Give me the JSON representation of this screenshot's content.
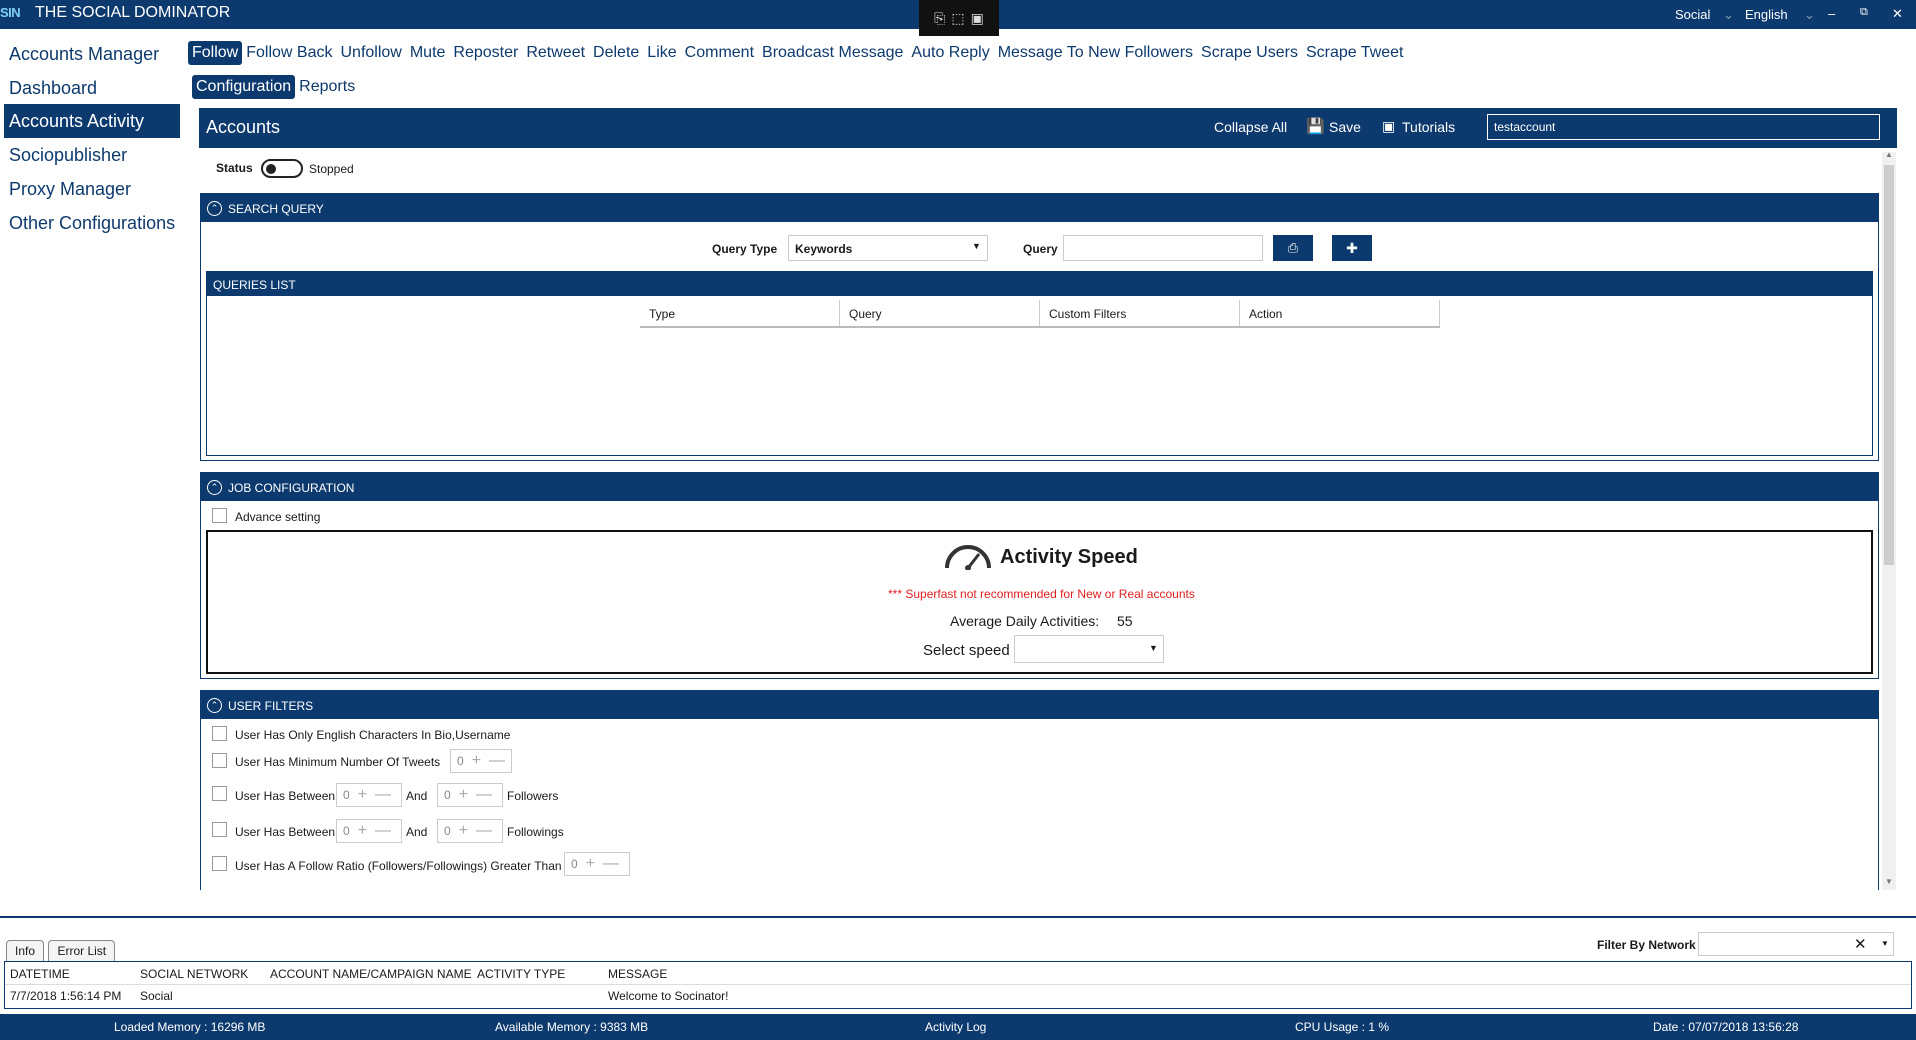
{
  "titlebar": {
    "logo": "SIN",
    "title": "THE SOCIAL DOMINATOR",
    "network": "Social",
    "language": "English",
    "minimize": "–",
    "restore": "⧉",
    "close": "✕"
  },
  "nav": {
    "items": [
      "Accounts Manager",
      "Dashboard",
      "Accounts Activity",
      "Sociopublisher",
      "Proxy Manager",
      "Other Configurations"
    ],
    "active_index": 2
  },
  "tabs": {
    "primary": [
      "Follow",
      "Follow Back",
      "Unfollow",
      "Mute",
      "Reposter",
      "Retweet",
      "Delete",
      "Like",
      "Comment",
      "Broadcast Message",
      "Auto Reply",
      "Message To New Followers",
      "Scrape Users",
      "Scrape Tweet"
    ],
    "secondary": [
      "Configuration",
      "Reports"
    ]
  },
  "accounts_bar": {
    "label": "Accounts",
    "collapse_all": "Collapse All",
    "save": "Save",
    "tutorials": "Tutorials",
    "account_value": "testaccount"
  },
  "status": {
    "label": "Status",
    "value": "Stopped"
  },
  "search_query": {
    "title": "SEARCH QUERY",
    "query_type_label": "Query Type",
    "query_type_value": "Keywords",
    "query_label": "Query",
    "query_value": "",
    "queries_list_title": "QUERIES LIST",
    "columns": [
      "Type",
      "Query",
      "Custom Filters",
      "Action"
    ]
  },
  "job_config": {
    "title": "JOB CONFIGURATION",
    "advance_setting": "Advance setting",
    "activity_speed_title": "Activity Speed",
    "warning": "*** Superfast not recommended for New or Real accounts",
    "avg_label": "Average Daily Activities:",
    "avg_value": "55",
    "select_speed_label": "Select speed",
    "select_speed_value": ""
  },
  "user_filters": {
    "title": "USER FILTERS",
    "f1": "User Has Only English Characters In Bio,Username",
    "f2": "User Has Minimum Number Of Tweets",
    "f3": "User Has Between",
    "and": "And",
    "followers": "Followers",
    "followings": "Followings",
    "f5": "User Has A Follow Ratio (Followers/Followings) Greater Than",
    "zero": "0"
  },
  "log": {
    "tab_info": "Info",
    "tab_errors": "Error List",
    "filter_label": "Filter By Network",
    "columns": [
      "DATETIME",
      "SOCIAL NETWORK",
      "ACCOUNT NAME/CAMPAIGN NAME",
      "ACTIVITY TYPE",
      "MESSAGE"
    ],
    "row": [
      "7/7/2018 1:56:14 PM",
      "Social",
      "",
      "",
      "Welcome to Socinator!"
    ]
  },
  "statusbar": {
    "loaded_memory": "Loaded Memory : 16296 MB",
    "available_memory": "Available Memory : 9383  MB",
    "activity_log": "Activity Log",
    "cpu": "CPU Usage : 1 %",
    "date": "Date : 07/07/2018 13:56:28"
  },
  "colors": {
    "primary": "#0d3a6e",
    "warning": "#e02020"
  }
}
